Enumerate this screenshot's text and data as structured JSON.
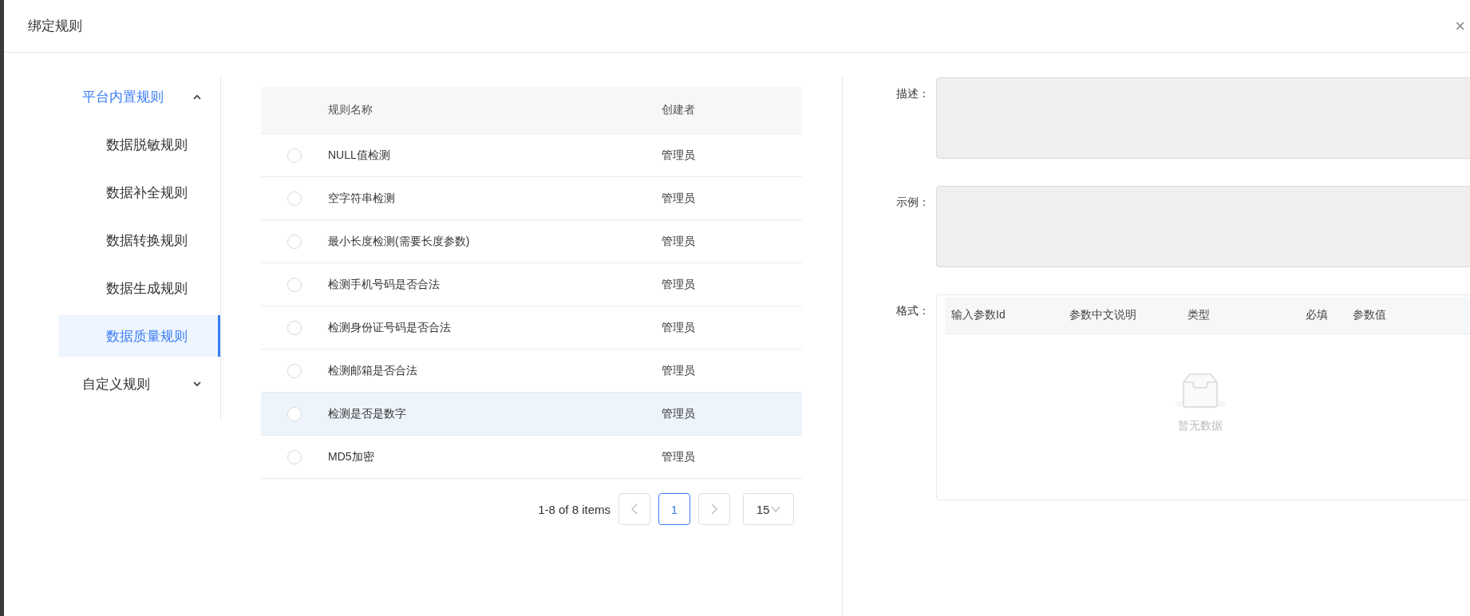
{
  "dialog": {
    "title": "绑定规则",
    "close": "×"
  },
  "menu": [
    {
      "label": "平台内置规则",
      "expanded": true,
      "children": [
        {
          "label": "数据脱敏规则",
          "selected": false
        },
        {
          "label": "数据补全规则",
          "selected": false
        },
        {
          "label": "数据转换规则",
          "selected": false
        },
        {
          "label": "数据生成规则",
          "selected": false
        },
        {
          "label": "数据质量规则",
          "selected": true
        }
      ]
    },
    {
      "label": "自定义规则",
      "expanded": false
    }
  ],
  "table": {
    "columns": [
      "规则名称",
      "创建者"
    ],
    "rows": [
      {
        "name": "NULL值检测",
        "creator": "管理员",
        "selected": false,
        "hovered": false
      },
      {
        "name": "空字符串检测",
        "creator": "管理员",
        "selected": false,
        "hovered": false
      },
      {
        "name": "最小长度检测(需要长度参数)",
        "creator": "管理员",
        "selected": false,
        "hovered": false
      },
      {
        "name": "检测手机号码是否合法",
        "creator": "管理员",
        "selected": false,
        "hovered": false
      },
      {
        "name": "检测身份证号码是否合法",
        "creator": "管理员",
        "selected": false,
        "hovered": false
      },
      {
        "name": "检测邮箱是否合法",
        "creator": "管理员",
        "selected": false,
        "hovered": false
      },
      {
        "name": "检测是否是数字",
        "creator": "管理员",
        "selected": false,
        "hovered": true
      },
      {
        "name": "MD5加密",
        "creator": "管理员",
        "selected": false,
        "hovered": false
      }
    ]
  },
  "pagination": {
    "total": "1-8 of 8 items",
    "pages": [
      {
        "label": "1",
        "selected": true
      }
    ],
    "page_size": "15"
  },
  "details": {
    "fields": [
      {
        "label": "描述：",
        "disabled": true
      },
      {
        "label": "示例：",
        "disabled": true
      }
    ],
    "format": {
      "label": "格式：",
      "columns": [
        "输入参数Id",
        "参数中文说明",
        "类型",
        "必填",
        "参数值"
      ],
      "empty_text": "暂无数据"
    }
  }
}
